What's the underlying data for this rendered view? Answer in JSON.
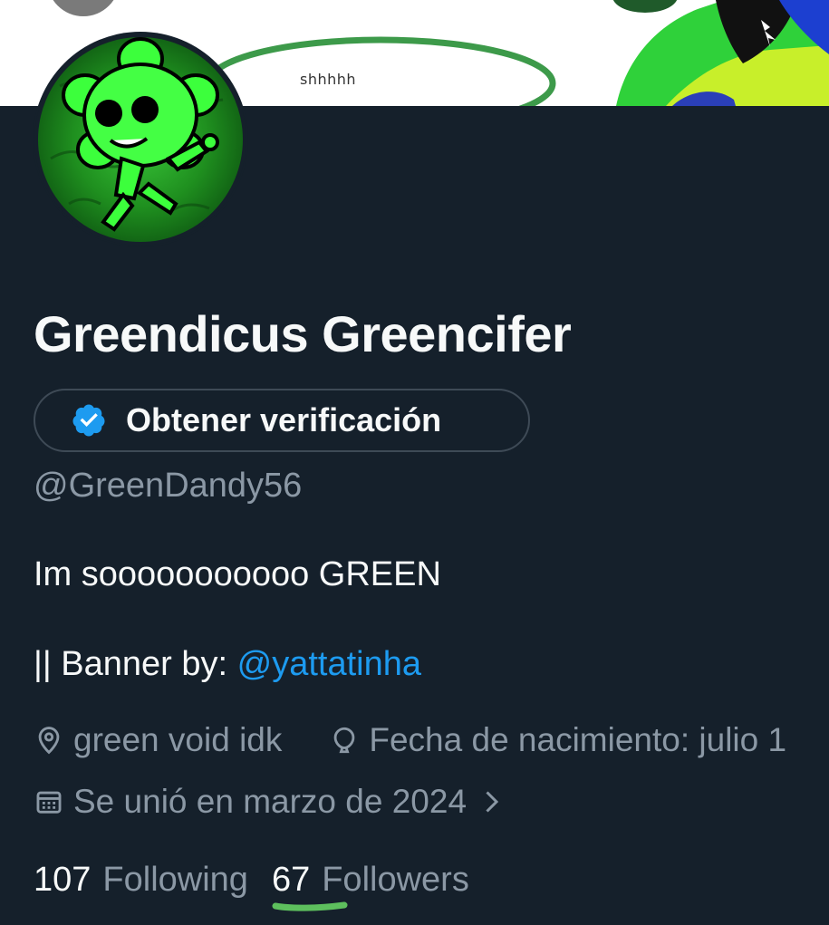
{
  "banner": {
    "caption": "shhhhh"
  },
  "profile": {
    "display_name": "Greendicus Greencifer",
    "verify_button_label": "Obtener verificación",
    "handle": "@GreenDandy56",
    "bio_line1": "Im sooooooooooo GREEN",
    "bio_line2_prefix": "|| Banner by: ",
    "bio_mention": "@yattatinha",
    "location": "green void idk",
    "birthday": "Fecha de nacimiento: julio 1",
    "joined": "Se unió en marzo de 2024"
  },
  "stats": {
    "following_count": "107",
    "following_label": "Following",
    "followers_count": "67",
    "followers_label": "Followers"
  },
  "colors": {
    "background": "#15202b",
    "primary_text": "#f7f9f9",
    "secondary_text": "#8b98a5",
    "accent": "#1d9bf0",
    "underline_mark": "#5dbf5d"
  },
  "icons": {
    "verified": "verified-badge-icon",
    "location": "location-pin-icon",
    "birthday": "balloon-icon",
    "joined": "calendar-icon",
    "expand": "chevron-right-icon"
  }
}
